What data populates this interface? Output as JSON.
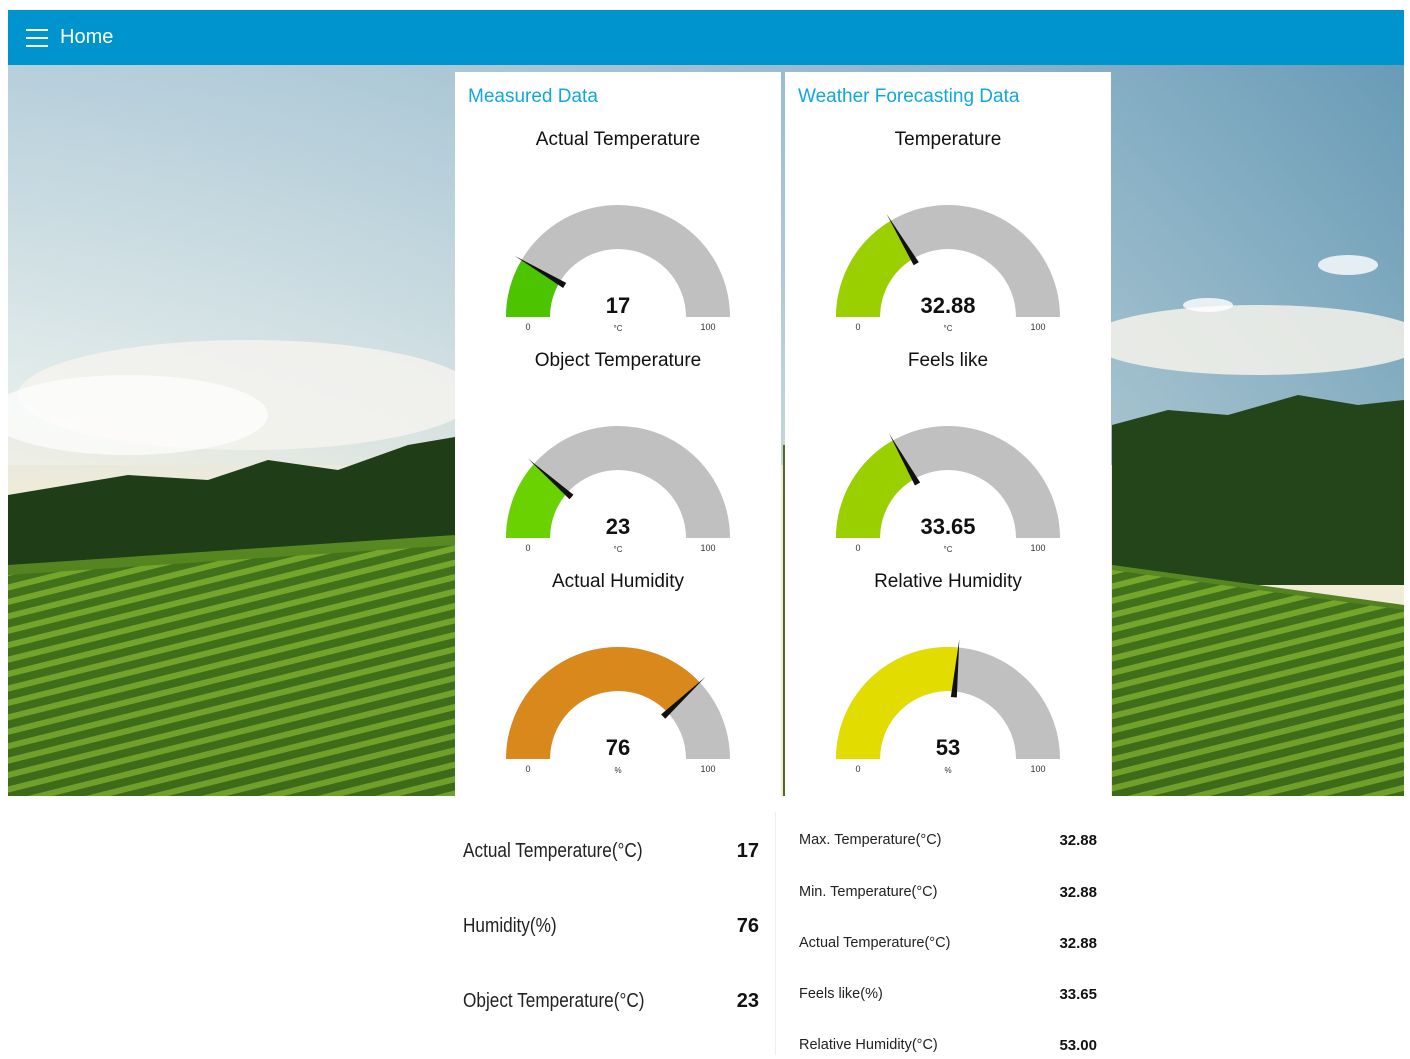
{
  "header": {
    "title": "Home",
    "menu_icon": "hamburger-menu-icon"
  },
  "colors": {
    "header": "#0094ce",
    "card_title": "#0fa8dc",
    "gauge_track": "#c0c0c0"
  },
  "measured": {
    "title": "Measured Data",
    "gauges": [
      {
        "title": "Actual Temperature",
        "value": "17",
        "number": 17,
        "unit": "°C",
        "min": "0",
        "max": "100",
        "color": "#4cc400"
      },
      {
        "title": "Object Temperature",
        "value": "23",
        "number": 23,
        "unit": "°C",
        "min": "0",
        "max": "100",
        "color": "#6ad200"
      },
      {
        "title": "Actual Humidity",
        "value": "76",
        "number": 76,
        "unit": "%",
        "min": "0",
        "max": "100",
        "color": "#d9891c"
      }
    ]
  },
  "forecast": {
    "title": "Weather Forecasting Data",
    "gauges": [
      {
        "title": "Temperature",
        "value": "32.88",
        "number": 32.88,
        "unit": "°C",
        "min": "0",
        "max": "100",
        "color": "#9ad000"
      },
      {
        "title": "Feels like",
        "value": "33.65",
        "number": 33.65,
        "unit": "°C",
        "min": "0",
        "max": "100",
        "color": "#9ad000"
      },
      {
        "title": "Relative Humidity",
        "value": "53",
        "number": 53,
        "unit": "%",
        "min": "0",
        "max": "100",
        "color": "#e2dc00"
      }
    ]
  },
  "left_table": [
    {
      "label": "Actual Temperature(°C)",
      "value": "17"
    },
    {
      "label": "Humidity(%)",
      "value": "76"
    },
    {
      "label": "Object Temperature(°C)",
      "value": "23"
    }
  ],
  "right_table": [
    {
      "label": "Max. Temperature(°C)",
      "value": "32.88"
    },
    {
      "label": "Min. Temperature(°C)",
      "value": "32.88"
    },
    {
      "label": "Actual Temperature(°C)",
      "value": "32.88"
    },
    {
      "label": "Feels like(%)",
      "value": "33.65"
    },
    {
      "label": "Relative Humidity(°C)",
      "value": "53.00"
    }
  ]
}
